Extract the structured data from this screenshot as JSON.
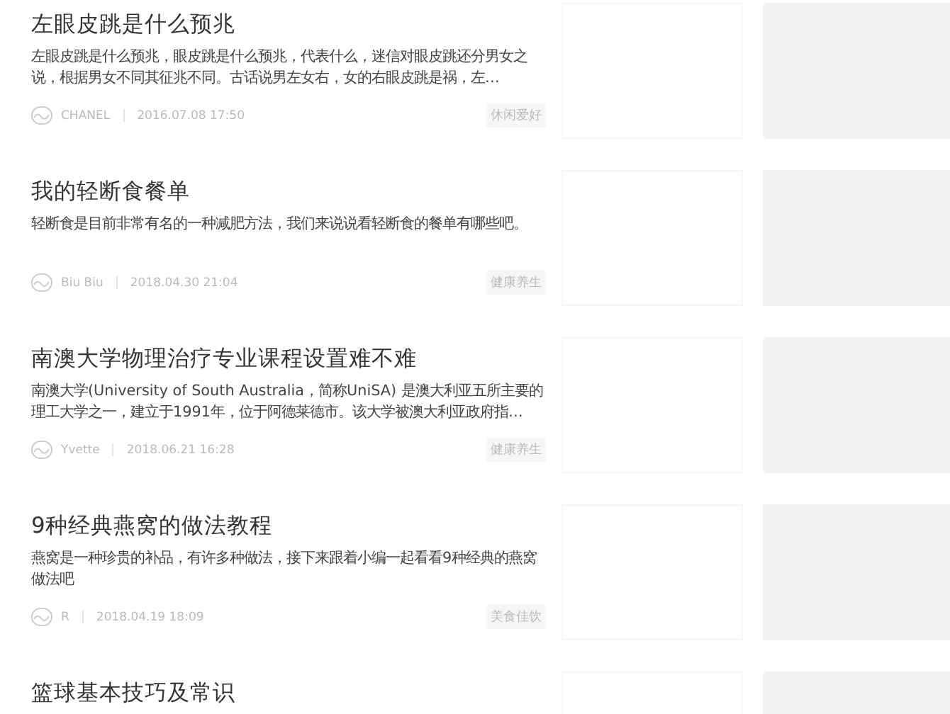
{
  "articles": [
    {
      "title": "左眼皮跳是什么预兆",
      "summary": "左眼皮跳是什么预兆，眼皮跳是什么预兆，代表什么，迷信对眼皮跳还分男女之说，根据男女不同其征兆不同。古话说男左女右，女的右眼皮跳是祸，左…",
      "author": "CHANEL",
      "date": "2016.07.08 17:50",
      "category": "休闲爱好"
    },
    {
      "title": "我的轻断食餐单",
      "summary": "轻断食是目前非常有名的一种减肥方法，我们来说说看轻断食的餐单有哪些吧。",
      "author": "Biu Biu",
      "date": "2018.04.30 21:04",
      "category": "健康养生"
    },
    {
      "title": "南澳大学物理治疗专业课程设置难不难",
      "summary": "南澳大学(University of South Australia，简称UniSA) 是澳大利亚五所主要的理工大学之一，建立于1991年，位于阿德莱德市。该大学被澳大利亚政府指…",
      "author": "Yvette",
      "date": "2018.06.21 16:28",
      "category": "健康养生"
    },
    {
      "title": "9种经典燕窝的做法教程",
      "summary": "燕窝是一种珍贵的补品，有许多种做法，接下来跟着小编一起看看9种经典的燕窝做法吧",
      "author": "R",
      "date": "2018.04.19 18:09",
      "category": "美食佳饮"
    },
    {
      "title": "篮球基本技巧及常识"
    }
  ]
}
